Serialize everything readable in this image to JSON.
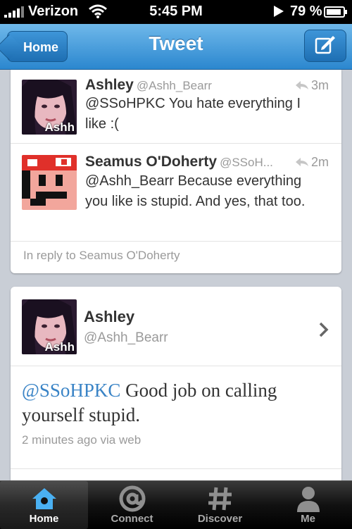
{
  "status_bar": {
    "carrier": "Verizon",
    "time": "5:45 PM",
    "battery": "79 %"
  },
  "nav": {
    "back_label": "Home",
    "title": "Tweet"
  },
  "thread": {
    "tweets": [
      {
        "name": "Ashley",
        "handle": "@Ashh_Bearr",
        "time": "3m",
        "text": "@SSoHPKC You hate everything I like :(",
        "avatar_label": "Ashh"
      },
      {
        "name": "Seamus O'Doherty",
        "handle": "@SSoH...",
        "time": "2m",
        "text": "@Ashh_Bearr Because everything you like is stupid. And yes, that too."
      }
    ],
    "reply_note": "In reply to Seamus O'Doherty"
  },
  "detail": {
    "name": "Ashley",
    "handle": "@Ashh_Bearr",
    "avatar_label": "Ashh",
    "mention": "@SSoHPKC",
    "text": " Good job on calling yourself stupid.",
    "meta": "2 minutes ago via web"
  },
  "tabs": [
    {
      "label": "Home",
      "icon": "home-icon",
      "active": true
    },
    {
      "label": "Connect",
      "icon": "at-icon",
      "active": false
    },
    {
      "label": "Discover",
      "icon": "hash-icon",
      "active": false
    },
    {
      "label": "Me",
      "icon": "person-icon",
      "active": false
    }
  ],
  "colors": {
    "nav_blue": "#2b87cf",
    "link_blue": "#3a84c6"
  }
}
